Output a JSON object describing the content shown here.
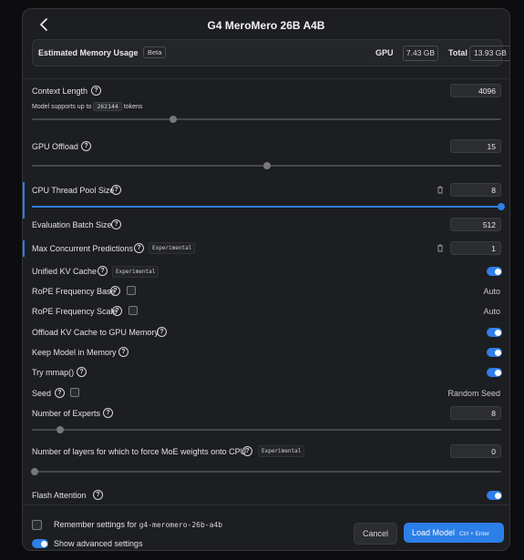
{
  "dialog": {
    "title": "G4 MeroMero 26B A4B",
    "back_icon": "chevron-left-icon"
  },
  "memory": {
    "label": "Estimated Memory Usage",
    "badge": "Beta",
    "gpu_label": "GPU",
    "gpu_value": "7.43 GB",
    "total_label": "Total",
    "total_value": "13.93 GB"
  },
  "settings": {
    "context_length": {
      "label": "Context Length",
      "value": "4096",
      "note_prefix": "Model supports up to",
      "note_value": "262144",
      "note_suffix": "tokens",
      "slider_fraction": 0.3
    },
    "gpu_offload": {
      "label": "GPU Offload",
      "value": "15",
      "slider_fraction": 0.5
    },
    "cpu_thread_pool": {
      "label": "CPU Thread Pool Size",
      "value": "8",
      "slider_fraction": 1.0
    },
    "eval_batch_size": {
      "label": "Evaluation Batch Size",
      "value": "512"
    },
    "max_concurrent": {
      "label": "Max Concurrent Predictions",
      "badge": "Experimental",
      "value": "1"
    },
    "unified_kv_cache": {
      "label": "Unified KV Cache",
      "badge": "Experimental",
      "enabled": true
    },
    "rope_freq_base": {
      "label": "RoPE Frequency Base",
      "value": "Auto",
      "checked": false
    },
    "rope_freq_scale": {
      "label": "RoPE Frequency Scale",
      "value": "Auto",
      "checked": false
    },
    "offload_kv": {
      "label": "Offload KV Cache to GPU Memory",
      "enabled": true
    },
    "keep_in_memory": {
      "label": "Keep Model in Memory",
      "enabled": true
    },
    "try_mmap": {
      "label": "Try mmap()",
      "enabled": true
    },
    "seed": {
      "label": "Seed",
      "value": "Random Seed",
      "checked": false
    },
    "num_experts": {
      "label": "Number of Experts",
      "value": "8",
      "slider_fraction": 0.06
    },
    "moe_cpu_layers": {
      "label": "Number of layers for which to force MoE weights onto CPU",
      "badge": "Experimental",
      "value": "0",
      "slider_fraction": 0.0
    },
    "flash_attention": {
      "label": "Flash Attention",
      "enabled": true
    }
  },
  "footer": {
    "remember_label": "Remember settings for",
    "remember_model": "g4-meromero-26b-a4b",
    "remember_checked": false,
    "advanced_label": "Show advanced settings",
    "advanced_enabled": true,
    "cancel_label": "Cancel",
    "load_label": "Load Model",
    "load_shortcut": "Ctrl + Enter"
  },
  "colors": {
    "accent": "#2f7fe6",
    "background": "#1d1e21"
  }
}
